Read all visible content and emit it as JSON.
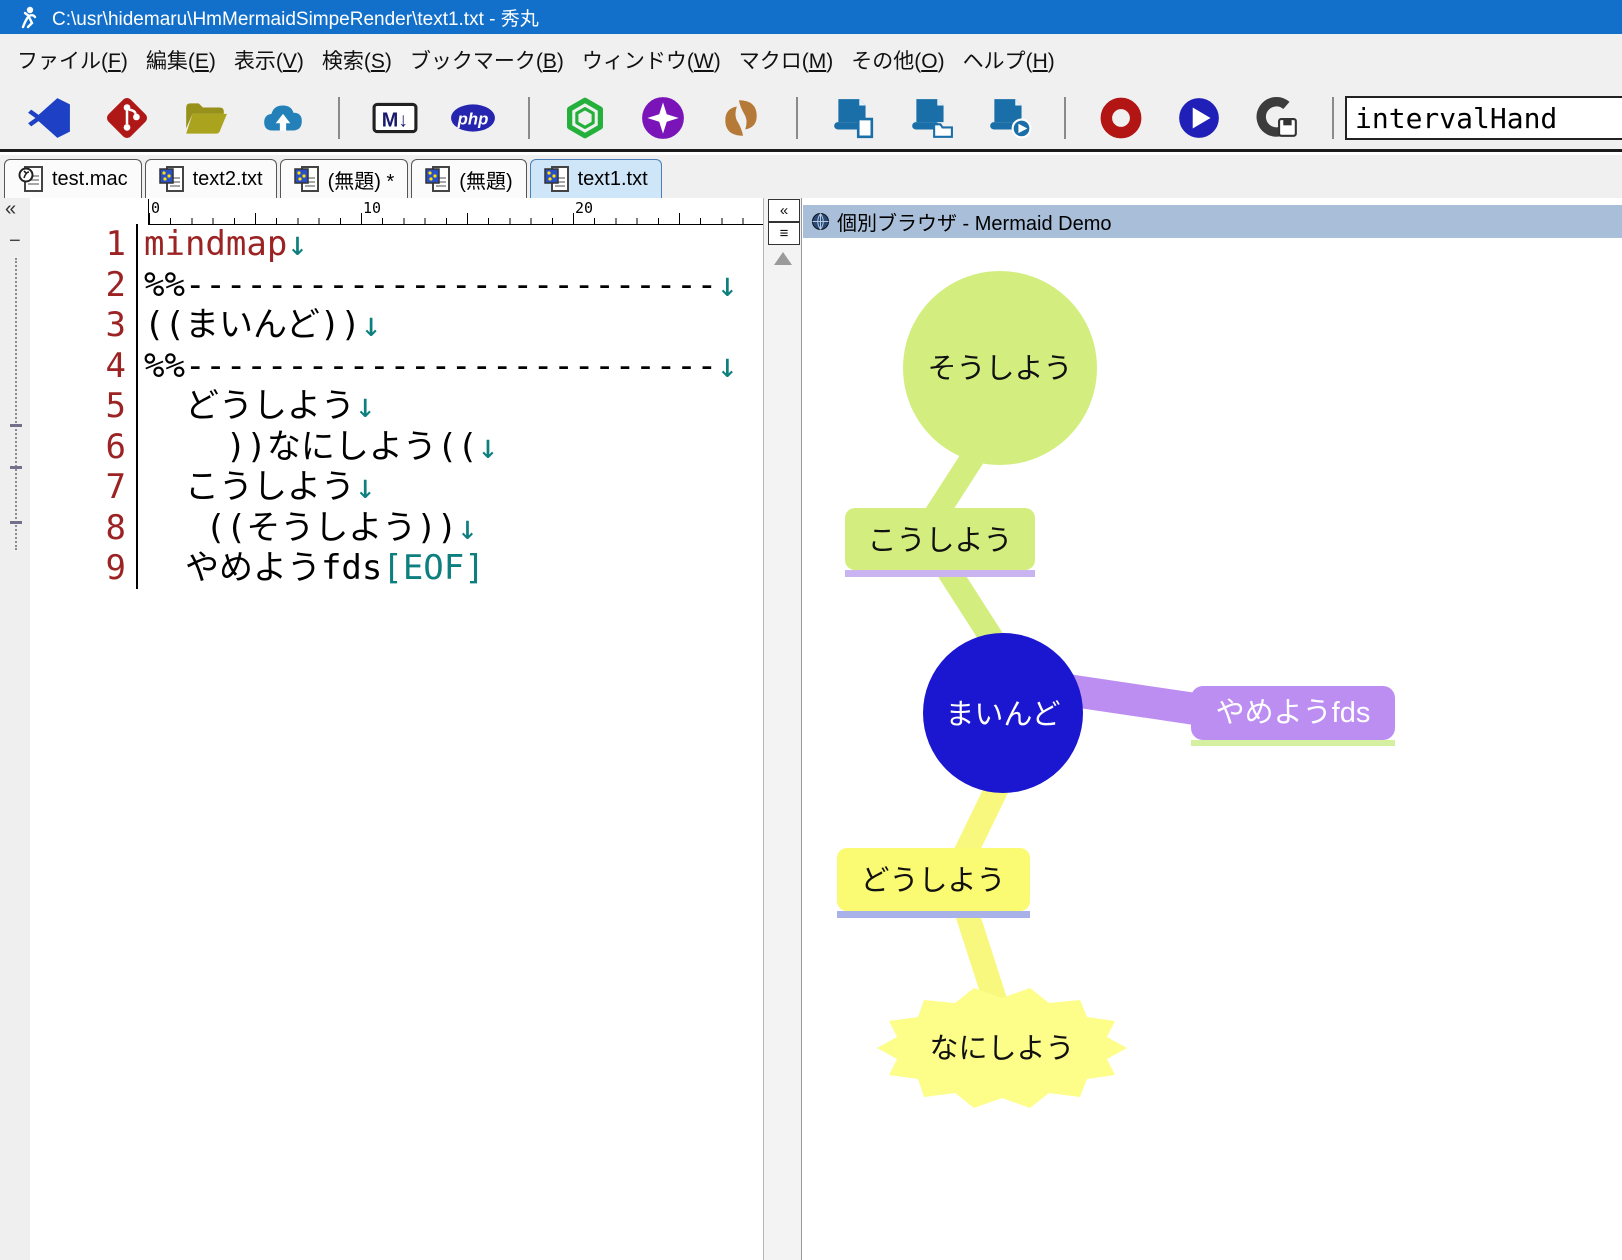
{
  "window": {
    "title": "C:\\usr\\hidemaru\\HmMermaidSimpeRender\\text1.txt  - 秀丸"
  },
  "menu": {
    "items": [
      {
        "pre": "ファイル(",
        "key": "F",
        "post": ")"
      },
      {
        "pre": "編集(",
        "key": "E",
        "post": ")"
      },
      {
        "pre": "表示(",
        "key": "V",
        "post": ")"
      },
      {
        "pre": "検索(",
        "key": "S",
        "post": ")"
      },
      {
        "pre": "ブックマーク(",
        "key": "B",
        "post": ")"
      },
      {
        "pre": "ウィンドウ(",
        "key": "W",
        "post": ")"
      },
      {
        "pre": "マクロ(",
        "key": "M",
        "post": ")"
      },
      {
        "pre": "その他(",
        "key": "O",
        "post": ")"
      },
      {
        "pre": "ヘルプ(",
        "key": "H",
        "post": ")"
      }
    ]
  },
  "toolbar": {
    "markdown_label": "M↓",
    "php_label": "php",
    "input_value": "intervalHand",
    "buttons": [
      "vscode",
      "git",
      "folder-open",
      "cloud-upload",
      "markdown",
      "php",
      "openai",
      "gemini",
      "claude",
      "macro-new",
      "macro-open",
      "macro-run",
      "macro-record",
      "macro-play",
      "macro-save"
    ]
  },
  "tabs": [
    {
      "label": "test.mac",
      "active": false
    },
    {
      "label": "text2.txt",
      "active": false
    },
    {
      "label": "(無題) *",
      "active": false
    },
    {
      "label": "(無題)",
      "active": false
    },
    {
      "label": "text1.txt",
      "active": true
    }
  ],
  "ui": {
    "collapse_glyph": "«",
    "outline_glyph": "≡",
    "minus_glyph": "−"
  },
  "editor": {
    "ruler": [
      "0",
      "10",
      "20"
    ],
    "lines": [
      {
        "num": "1",
        "keyword": "mindmap",
        "body": "",
        "trail": "↓"
      },
      {
        "num": "2",
        "keyword": "",
        "body": "%%--------------------------",
        "trail": "↓"
      },
      {
        "num": "3",
        "keyword": "",
        "body": "((まいんど))",
        "trail": "↓"
      },
      {
        "num": "4",
        "keyword": "",
        "body": "%%--------------------------",
        "trail": "↓"
      },
      {
        "num": "5",
        "keyword": "",
        "body": "  どうしよう",
        "trail": "↓"
      },
      {
        "num": "6",
        "keyword": "",
        "body": "    ))なにしよう((",
        "trail": "↓"
      },
      {
        "num": "7",
        "keyword": "",
        "body": "  こうしよう",
        "trail": "↓"
      },
      {
        "num": "8",
        "keyword": "",
        "body": "   ((そうしよう))",
        "trail": "↓"
      },
      {
        "num": "9",
        "keyword": "",
        "body": "  やめようfds",
        "trail": "[EOF]"
      }
    ]
  },
  "preview": {
    "titlebar": {
      "label": "個別ブラウザ - Mermaid Demo"
    },
    "mindmap": {
      "nodes": [
        {
          "id": "soushiyou",
          "label": "そうしよう",
          "shape": "circle",
          "fill": "#d3ee7f",
          "text_color": "#111111"
        },
        {
          "id": "koushiyou",
          "label": "こうしよう",
          "shape": "rounded-rect",
          "fill": "#d3ee7f",
          "underline": "#c9b3f0",
          "text_color": "#111111"
        },
        {
          "id": "maindo",
          "label": "まいんど",
          "shape": "circle",
          "fill": "#1b16cf",
          "text_color": "#ffffff"
        },
        {
          "id": "yameyoufds",
          "label": "やめようfds",
          "shape": "rounded-rect",
          "fill": "#bd8ef2",
          "underline": "#d6f0a2",
          "text_color": "#ffffff"
        },
        {
          "id": "doushiyou",
          "label": "どうしよう",
          "shape": "rounded-rect",
          "fill": "#fafa73",
          "underline": "#a9b2e8",
          "text_color": "#111111"
        },
        {
          "id": "nanishiyou",
          "label": "なにしよう",
          "shape": "bang",
          "fill": "#fdfd8a",
          "text_color": "#111111"
        }
      ],
      "edges": [
        {
          "from": "こうしよう",
          "to": "そうしよう",
          "color": "#d3ee7f"
        },
        {
          "from": "まいんど",
          "to": "こうしよう",
          "color": "#d3ee7f"
        },
        {
          "from": "まいんど",
          "to": "やめようfds",
          "color": "#bd8ef2"
        },
        {
          "from": "まいんど",
          "to": "どうしよう",
          "color": "#f8f87e"
        },
        {
          "from": "どうしよう",
          "to": "なにしよう",
          "color": "#f8f87e"
        }
      ]
    }
  },
  "colors": {
    "titlebar": "#1270cb",
    "panel_titlebar": "#a9bed8",
    "line_number": "#9b2323",
    "keyword": "#9b2323",
    "newline_arrow": "#0e7f7f",
    "eof_marker": "#0e7f7f",
    "active_tab": "#cfe5f8"
  }
}
